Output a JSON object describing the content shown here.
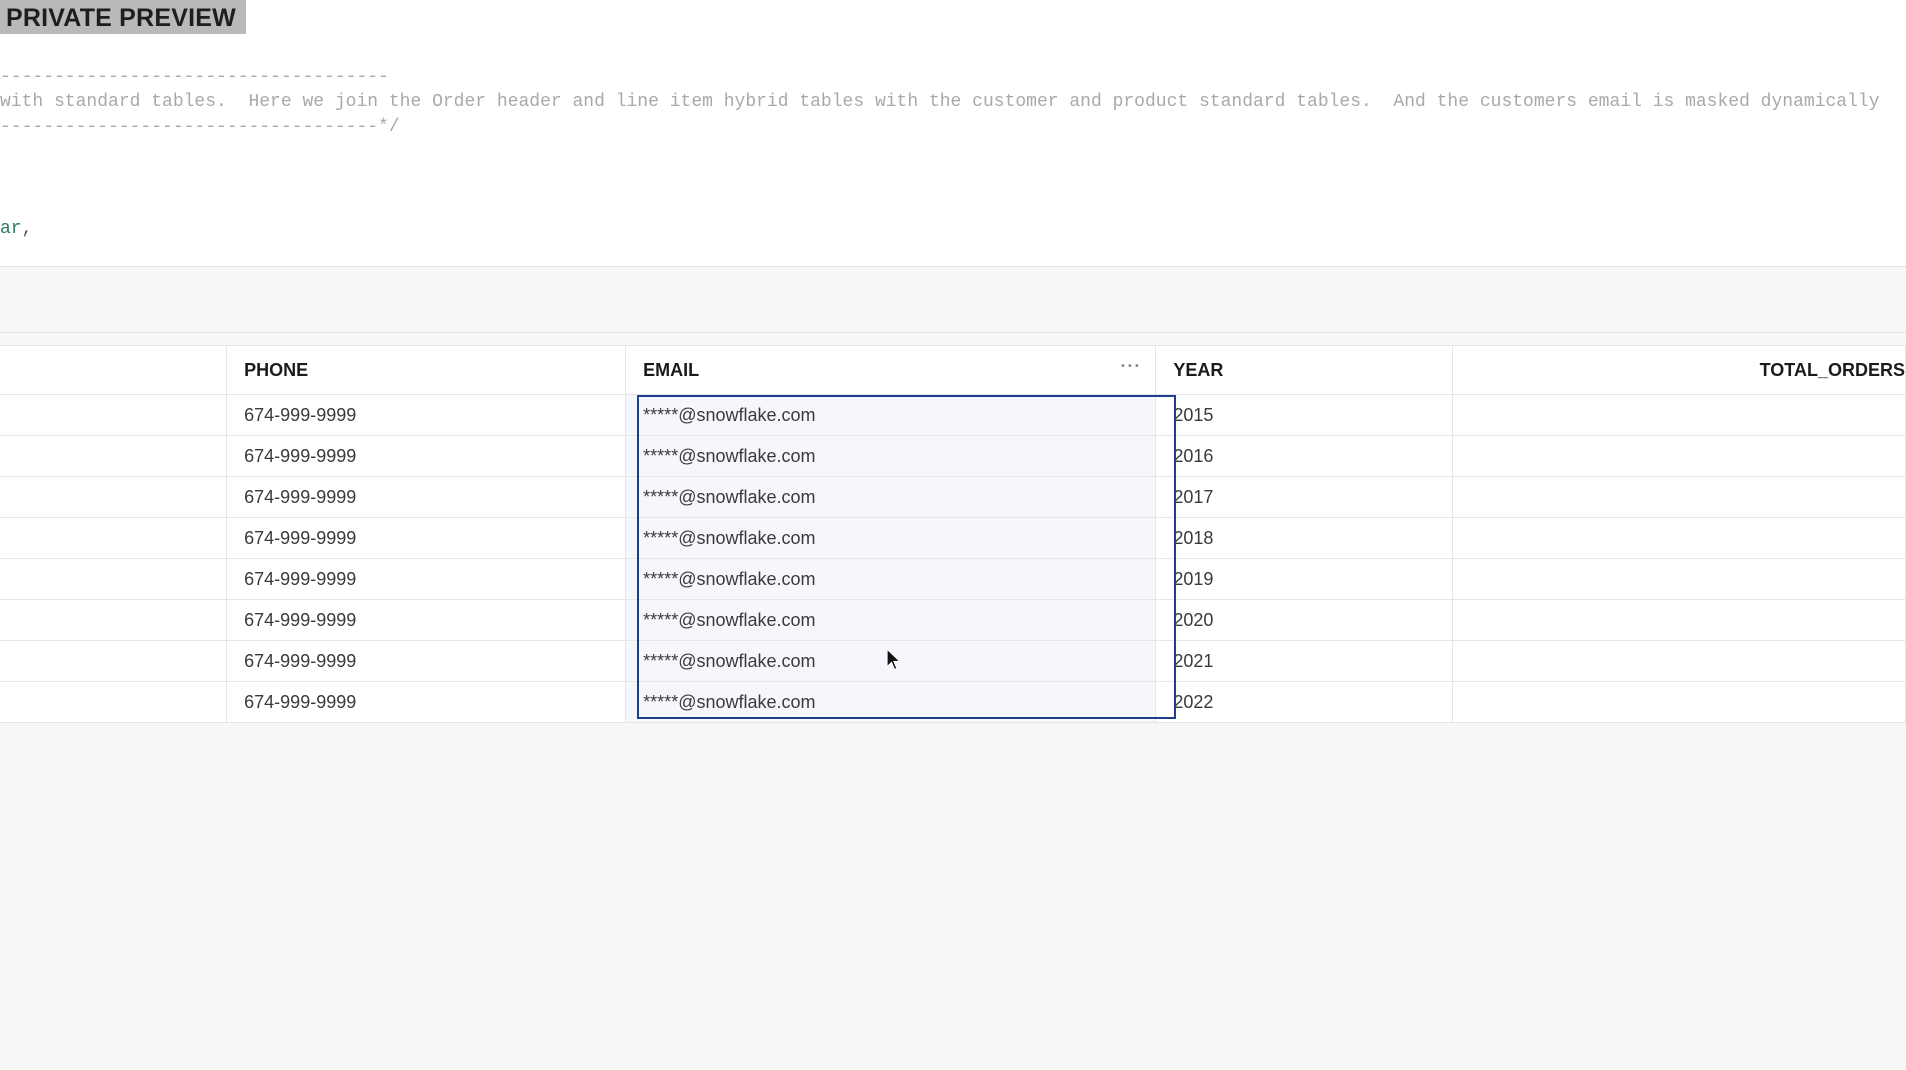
{
  "banner": {
    "label": "PRIVATE PREVIEW"
  },
  "editor": {
    "lines": [
      "------------------------------------",
      "with standard tables.  Here we join the Order header and line item hybrid tables with the customer and product standard tables.  And the customers email is masked dynamically",
      "-----------------------------------*/",
      "ar"
    ],
    "trailing_punct": ","
  },
  "results": {
    "columns": [
      "PHONE",
      "EMAIL",
      "YEAR",
      "TOTAL_ORDERS"
    ],
    "more_icon": "ellipsis-icon",
    "rows": [
      {
        "phone": "674-999-9999",
        "email": "*****@snowflake.com",
        "year": "2015"
      },
      {
        "phone": "674-999-9999",
        "email": "*****@snowflake.com",
        "year": "2016"
      },
      {
        "phone": "674-999-9999",
        "email": "*****@snowflake.com",
        "year": "2017"
      },
      {
        "phone": "674-999-9999",
        "email": "*****@snowflake.com",
        "year": "2018"
      },
      {
        "phone": "674-999-9999",
        "email": "*****@snowflake.com",
        "year": "2019"
      },
      {
        "phone": "674-999-9999",
        "email": "*****@snowflake.com",
        "year": "2020"
      },
      {
        "phone": "674-999-9999",
        "email": "*****@snowflake.com",
        "year": "2021"
      },
      {
        "phone": "674-999-9999",
        "email": "*****@snowflake.com",
        "year": "2022"
      }
    ],
    "selection_color": "#1d3f8f"
  }
}
